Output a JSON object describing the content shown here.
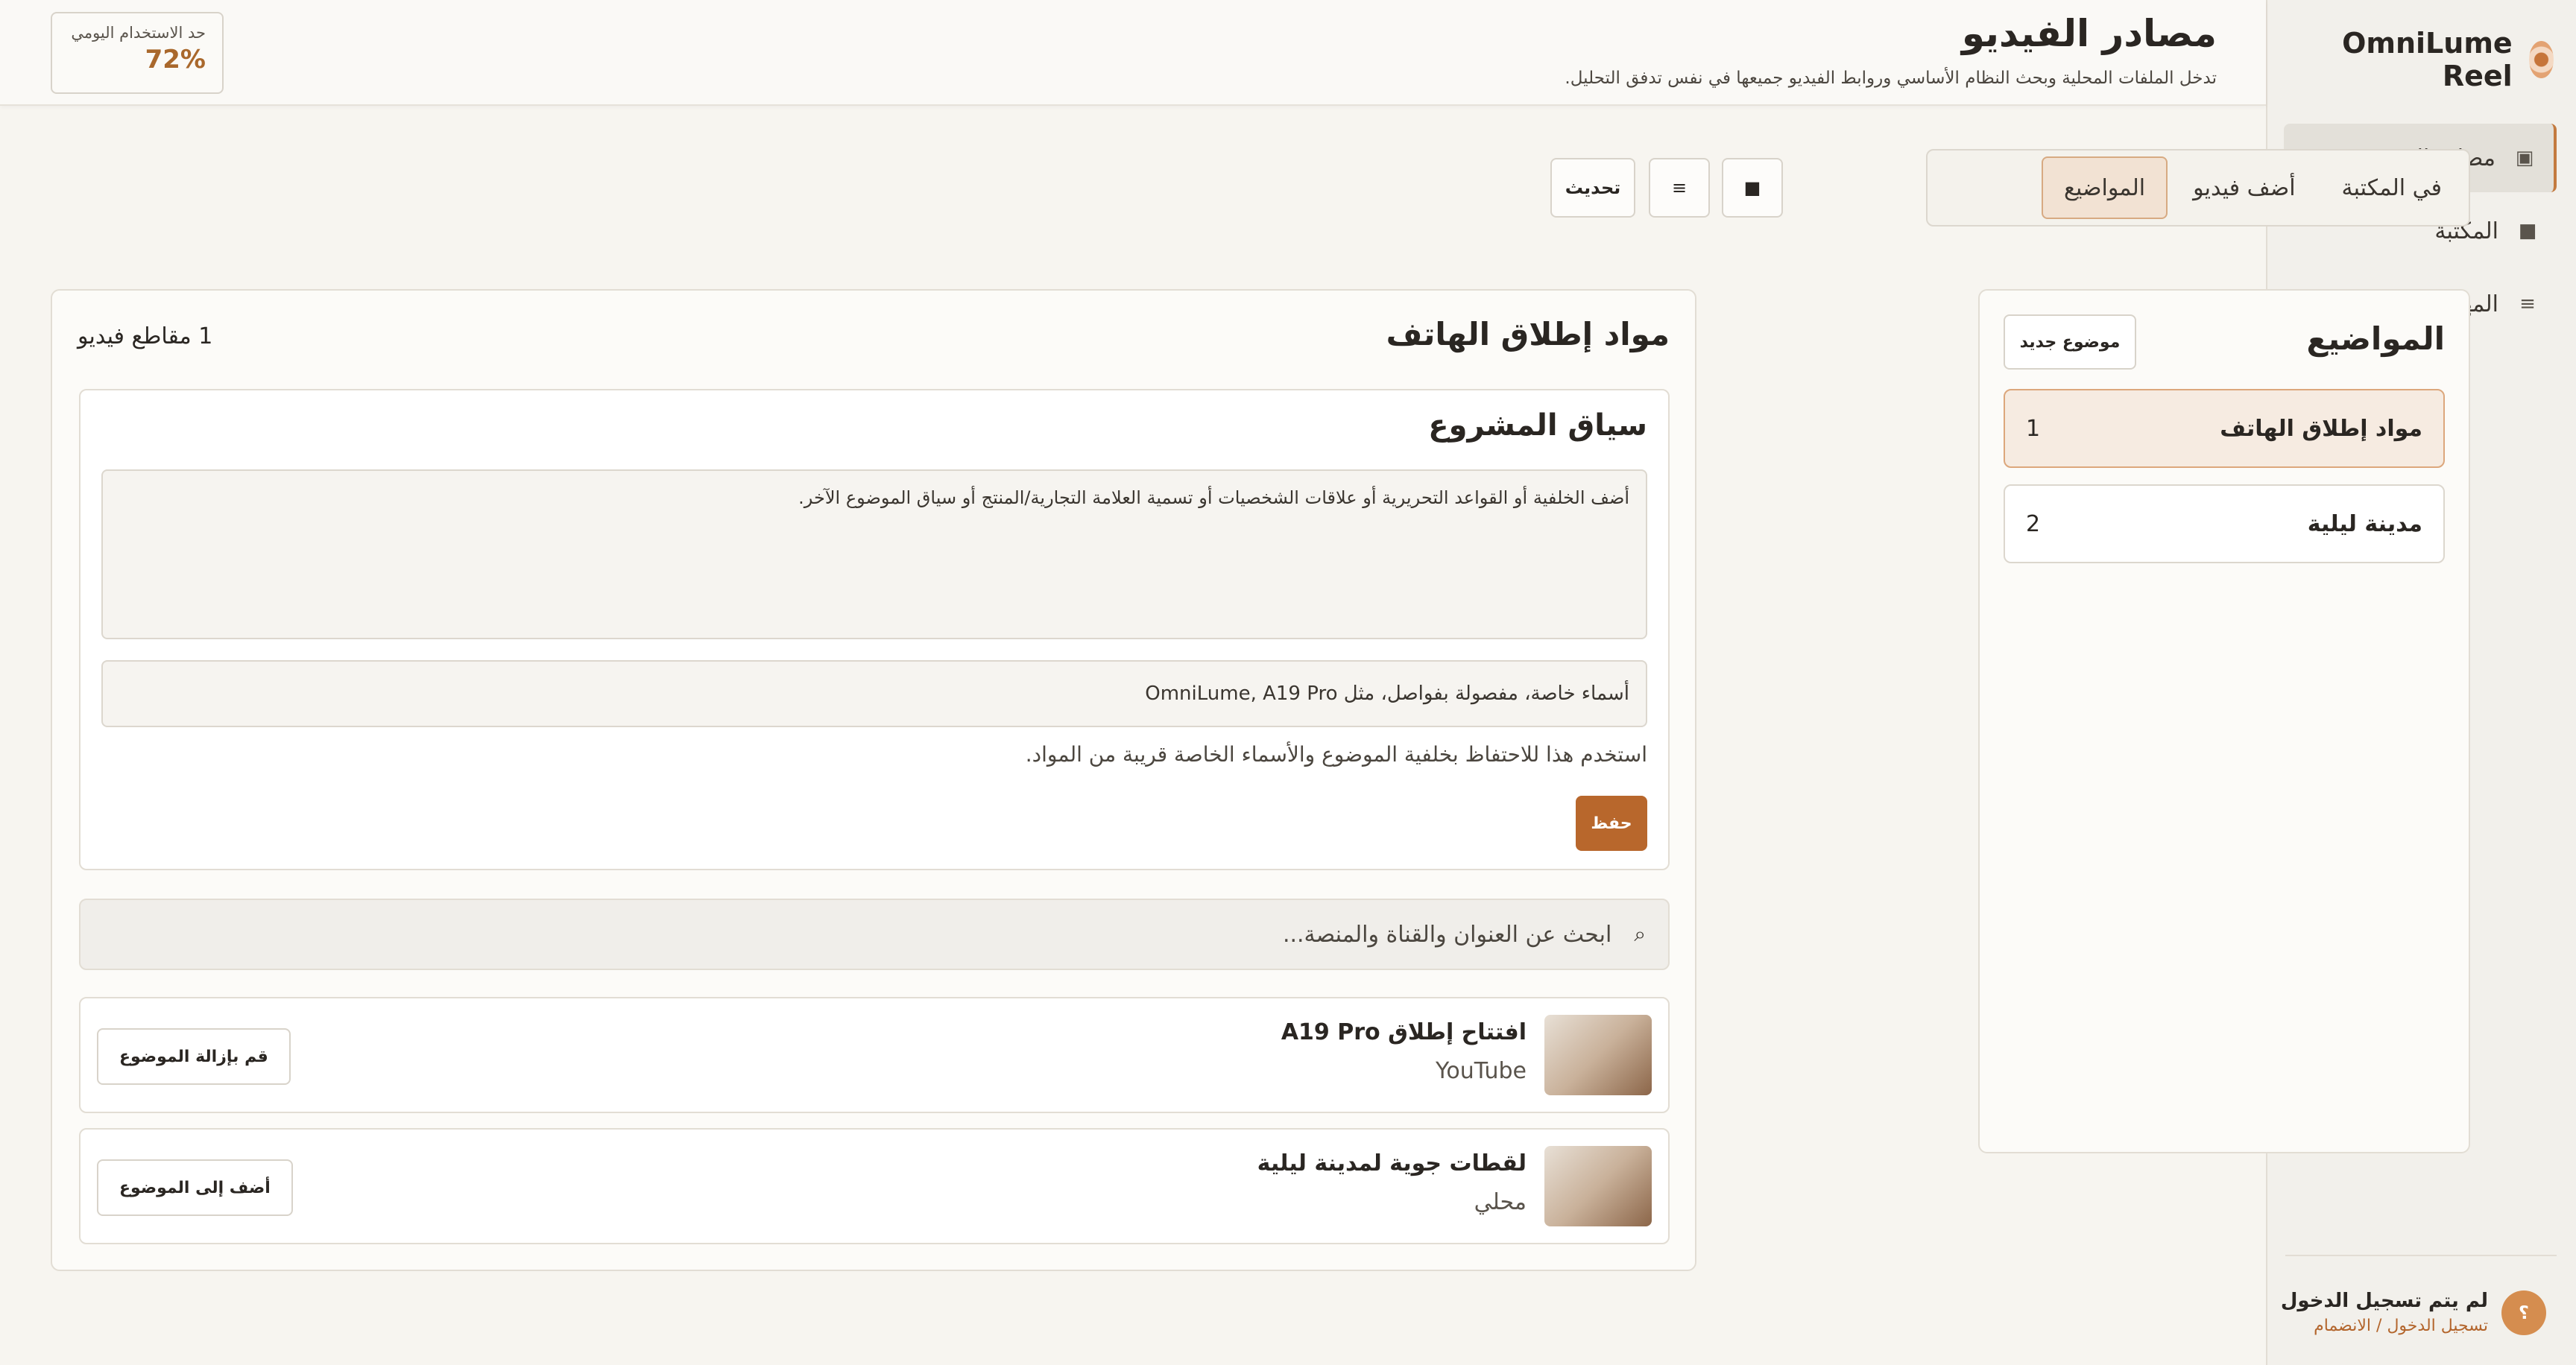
{
  "app": {
    "name": "OmniLume Reel"
  },
  "sidebar": {
    "items": [
      {
        "label": "مصادر الفيديو",
        "icon": "▣",
        "active": true
      },
      {
        "label": "المكتبة",
        "icon": "■",
        "active": false
      },
      {
        "label": "المهام",
        "icon": "≡",
        "active": false
      }
    ],
    "user": {
      "avatar": "؟",
      "name": "لم يتم تسجيل الدخول",
      "link": "تسجيل الدخول / الانضمام"
    }
  },
  "header": {
    "title": "مصادر الفيديو",
    "subtitle": "تدخل الملفات المحلية وبحث النظام الأساسي وروابط الفيديو جميعها في نفس تدفق التحليل.",
    "quota_label": "حد الاستخدام اليومي",
    "quota_value": "72%"
  },
  "toolbar": {
    "tabs": [
      {
        "label": "في المكتبة",
        "active": false
      },
      {
        "label": "أضف فيديو",
        "active": false
      },
      {
        "label": "المواضيع",
        "active": true
      }
    ],
    "grid_icon": "■",
    "list_icon": "≡",
    "refresh_label": "تحديث"
  },
  "topics": {
    "title": "المواضيع",
    "new_label": "موضوع جديد",
    "items": [
      {
        "name": "مواد إطلاق الهاتف",
        "count": "1",
        "active": true
      },
      {
        "name": "مدينة ليلية",
        "count": "2",
        "active": false
      }
    ]
  },
  "main": {
    "title": "مواد إطلاق الهاتف",
    "clip_count": "1 مقاطع فيديو",
    "context": {
      "title": "سياق المشروع",
      "textarea": "أضف الخلفية أو القواعد التحريرية أو علاقات الشخصيات أو تسمية العلامة التجارية/المنتج أو سياق الموضوع الآخر.",
      "names_placeholder": "أسماء خاصة، مفصولة بفواصل، مثل OmniLume, A19 Pro",
      "hint": "استخدم هذا للاحتفاظ بخلفية الموضوع والأسماء الخاصة قريبة من المواد.",
      "save_label": "حفظ"
    },
    "search": {
      "icon": "⌕",
      "placeholder": "ابحث عن العنوان والقناة والمنصة..."
    },
    "videos": [
      {
        "title": "افتتاح إطلاق A19 Pro",
        "source": "YouTube",
        "action": "قم بإزالة الموضوع"
      },
      {
        "title": "لقطات جوية لمدينة ليلية",
        "source": "محلي",
        "action": "أضف إلى الموضوع"
      }
    ]
  }
}
